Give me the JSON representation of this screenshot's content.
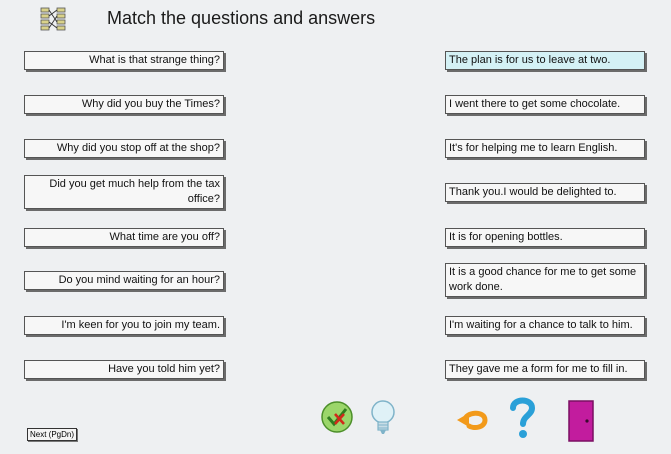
{
  "title": "Match the questions and answers",
  "questions": [
    "What is that strange thing?",
    "Why did you buy the Times?",
    "Why did you stop off at the shop?",
    "Did you get much help from the tax office?",
    "What time are you off?",
    "Do you mind waiting for an hour?",
    "I'm keen for you to join my team.",
    "Have you told him yet?"
  ],
  "answers": [
    "The plan is for us to leave at two.",
    "I went there to get some chocolate.",
    "It's for helping me to learn English.",
    "Thank you.I would be delighted to.",
    "It is for opening bottles.",
    "It is a good chance for me to get some work done.",
    "I'm waiting for a chance to talk to him.",
    "They gave me a form for me to fill in."
  ],
  "selected_answer_index": 0,
  "toolbar": {
    "next_label": "Next (PgDn)",
    "check_icon": "check-cross-icon",
    "hint_icon": "lightbulb-icon",
    "undo_icon": "undo-arrow-icon",
    "help_icon": "question-mark-icon",
    "exit_icon": "exit-door-icon"
  },
  "colors": {
    "selected_answer": "#d4f1f5",
    "help": "#2aa0d8",
    "undo": "#f29a1b",
    "exit": "#c21c9e",
    "check": "#3aa832"
  }
}
